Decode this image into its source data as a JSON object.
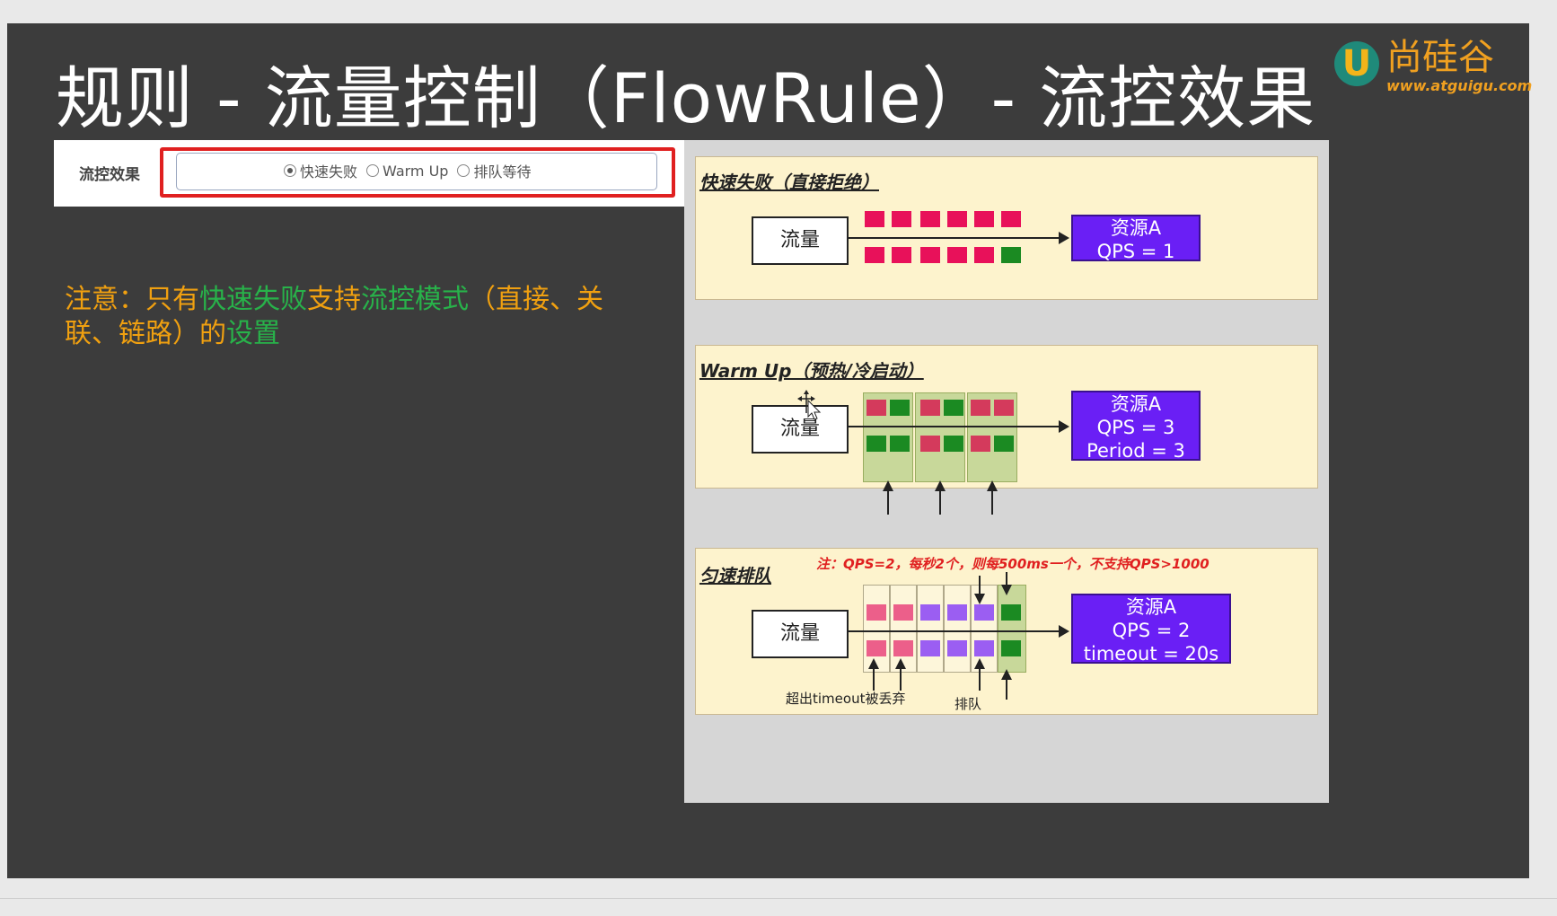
{
  "slide": {
    "title": "规则 - 流量控制（FlowRule）- 流控效果",
    "logo": {
      "letter": "U",
      "brand": "尚硅谷",
      "url": "www.atguigu.com"
    }
  },
  "form": {
    "label": "流控效果",
    "options": [
      {
        "label": "快速失败",
        "checked": true
      },
      {
        "label": "Warm Up",
        "checked": false
      },
      {
        "label": "排队等待",
        "checked": false
      }
    ]
  },
  "note": {
    "parts": [
      "注意：只有",
      "快速失败",
      "支持",
      "流控模式",
      "（直接、关联、链路）的",
      "设置"
    ]
  },
  "diagram": {
    "fast_fail": {
      "title": "快速失败（直接拒绝）",
      "flow": "流量",
      "resource_line1": "资源A",
      "resource_line2": "QPS = 1"
    },
    "warm_up": {
      "title": "Warm Up（预热/冷启动）",
      "flow": "流量",
      "resource_line1": "资源A",
      "resource_line2": "QPS = 3",
      "resource_line3": "Period = 3"
    },
    "queue": {
      "title": "匀速排队",
      "note": "注：QPS=2，每秒2个，则每500ms一个，不支持QPS>1000",
      "flow": "流量",
      "resource_line1": "资源A",
      "resource_line2": "QPS = 2",
      "resource_line3": "timeout = 20s",
      "label_drop": "超出timeout被丢弃",
      "label_queue": "排队"
    }
  },
  "colors": {
    "accent_orange": "#f0a010",
    "accent_green": "#28b24a",
    "resource_purple": "#6a1ff5",
    "red_box": "#e02020"
  }
}
